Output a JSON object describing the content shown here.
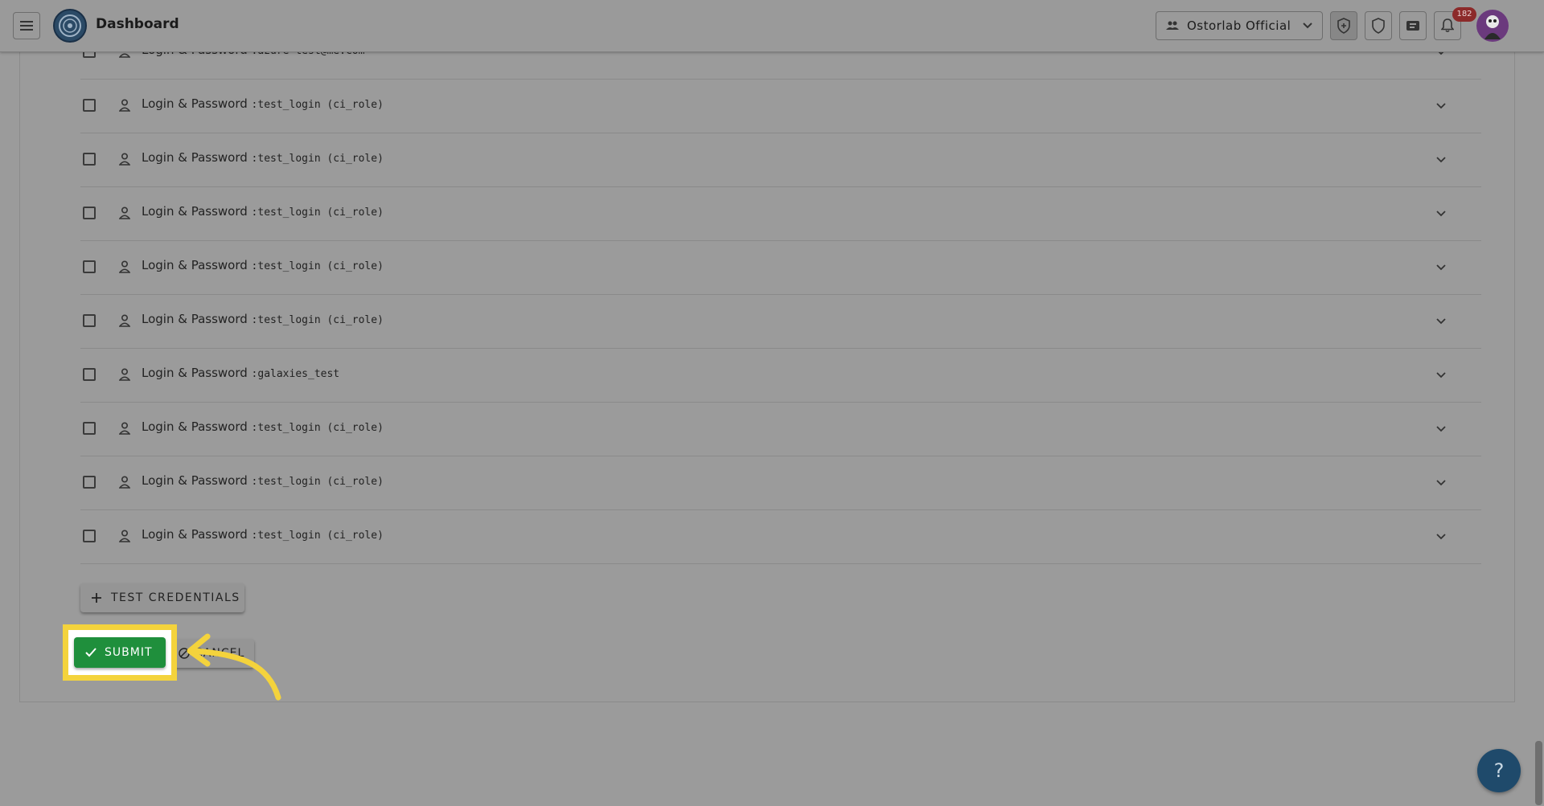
{
  "header": {
    "title": "Dashboard",
    "organization": "Ostorlab Official",
    "notification_count": "182"
  },
  "credentials": {
    "rows": [
      {
        "type": "Login & Password",
        "value": ":azure-test@me.com"
      },
      {
        "type": "Login & Password",
        "value": ":test_login (ci_role)"
      },
      {
        "type": "Login & Password",
        "value": ":test_login (ci_role)"
      },
      {
        "type": "Login & Password",
        "value": ":test_login (ci_role)"
      },
      {
        "type": "Login & Password",
        "value": ":test_login (ci_role)"
      },
      {
        "type": "Login & Password",
        "value": ":test_login (ci_role)"
      },
      {
        "type": "Login & Password",
        "value": ":galaxies_test"
      },
      {
        "type": "Login & Password",
        "value": ":test_login (ci_role)"
      },
      {
        "type": "Login & Password",
        "value": ":test_login (ci_role)"
      },
      {
        "type": "Login & Password",
        "value": ":test_login (ci_role)"
      }
    ]
  },
  "actions": {
    "test_credentials_label": "TEST CREDENTIALS",
    "submit_label": "SUBMIT",
    "cancel_label": "CANCEL"
  },
  "help": {
    "label": "?"
  },
  "colors": {
    "submit": "#1f8f3c",
    "highlight": "#f4d33c",
    "overlay": "#9b9b9b",
    "help": "#1f4a6b"
  }
}
